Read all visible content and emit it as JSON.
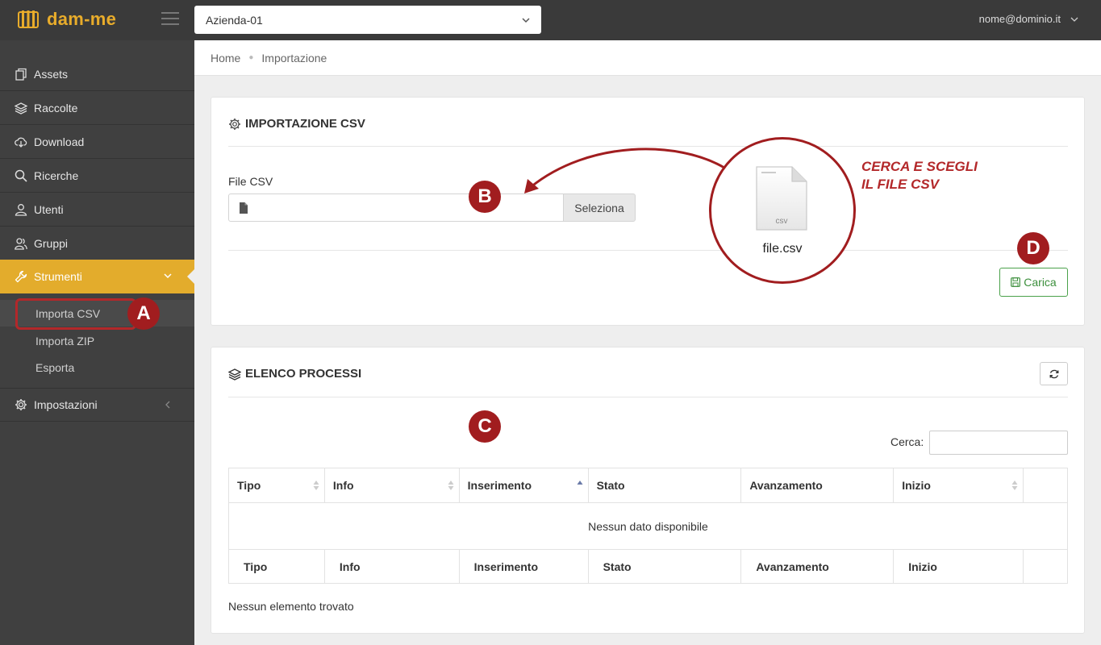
{
  "header": {
    "app_name": "dam-me",
    "company": "Azienda-01",
    "user_email": "nome@dominio.it"
  },
  "sidebar": {
    "items": [
      {
        "label": "Assets",
        "icon": "assets-icon"
      },
      {
        "label": "Raccolte",
        "icon": "layers-icon"
      },
      {
        "label": "Download",
        "icon": "cloud-download-icon"
      },
      {
        "label": "Ricerche",
        "icon": "search-icon"
      },
      {
        "label": "Utenti",
        "icon": "user-icon"
      },
      {
        "label": "Gruppi",
        "icon": "group-icon"
      },
      {
        "label": "Strumenti",
        "icon": "wrench-icon"
      },
      {
        "label": "Impostazioni",
        "icon": "gear-icon"
      }
    ],
    "sub_items": [
      "Importa CSV",
      "Importa ZIP",
      "Esporta"
    ],
    "accent_color": "#e3ac2c"
  },
  "breadcrumb": {
    "home": "Home",
    "current": "Importazione"
  },
  "import_card": {
    "title": "IMPORTAZIONE CSV",
    "file_label": "File CSV",
    "select_label": "Seleziona",
    "upload_label": "Carica"
  },
  "process_card": {
    "title": "ELENCO PROCESSI",
    "search_label": "Cerca:",
    "columns": [
      "Tipo",
      "Info",
      "Inserimento",
      "Stato",
      "Avanzamento",
      "Inizio"
    ],
    "empty_message": "Nessun dato disponibile",
    "footer_info": "Nessun elemento trovato"
  },
  "annotations": {
    "badges": [
      "A",
      "B",
      "C",
      "D"
    ],
    "callout_file": "file.csv",
    "callout_file_ext": "csv",
    "callout_line1": "CERCA E SCEGLI",
    "callout_line2": "IL FILE CSV",
    "color": "#a11d1f"
  }
}
